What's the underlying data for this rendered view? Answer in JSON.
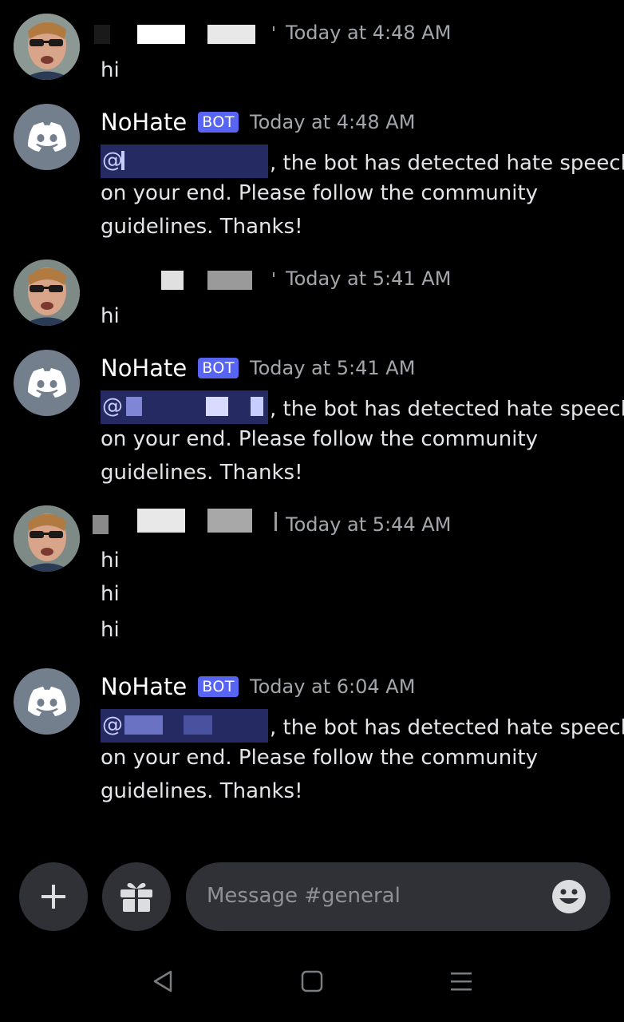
{
  "messages": [
    {
      "type": "user",
      "timestamp": "Today at 4:48 AM",
      "lines": [
        "hi"
      ]
    },
    {
      "type": "bot",
      "author": "NoHate",
      "badge": "BOT",
      "timestamp": "Today at 4:48 AM",
      "mention": "@",
      "line1": ", the bot has detected hate speech",
      "lines": [
        "on your end. Please follow the community",
        "guidelines. Thanks!"
      ]
    },
    {
      "type": "user",
      "timestamp": "Today at 5:41 AM",
      "lines": [
        "hi"
      ]
    },
    {
      "type": "bot",
      "author": "NoHate",
      "badge": "BOT",
      "timestamp": "Today at 5:41 AM",
      "mention": "@",
      "line1": ", the bot has detected hate speech",
      "lines": [
        "on your end. Please follow the community",
        "guidelines. Thanks!"
      ]
    },
    {
      "type": "user",
      "timestamp": "Today at 5:44 AM",
      "lines": [
        "hi",
        "hi",
        "hi"
      ]
    },
    {
      "type": "bot",
      "author": "NoHate",
      "badge": "BOT",
      "timestamp": "Today at 6:04 AM",
      "mention": "@",
      "line1": ", the bot has detected hate speech",
      "lines": [
        "on your end. Please follow the community",
        "guidelines. Thanks!"
      ]
    }
  ],
  "composer": {
    "placeholder": "Message #general",
    "add_icon": "plus-icon",
    "gift_icon": "gift-icon",
    "emoji_icon": "emoji-icon"
  },
  "nav": {
    "back_icon": "back-triangle-icon",
    "home_icon": "home-square-icon",
    "menu_icon": "menu-lines-icon"
  },
  "colors": {
    "background": "#000000",
    "badge": "#5865f2",
    "mention_bg": "#252a62",
    "input_bg": "#2f3136"
  }
}
